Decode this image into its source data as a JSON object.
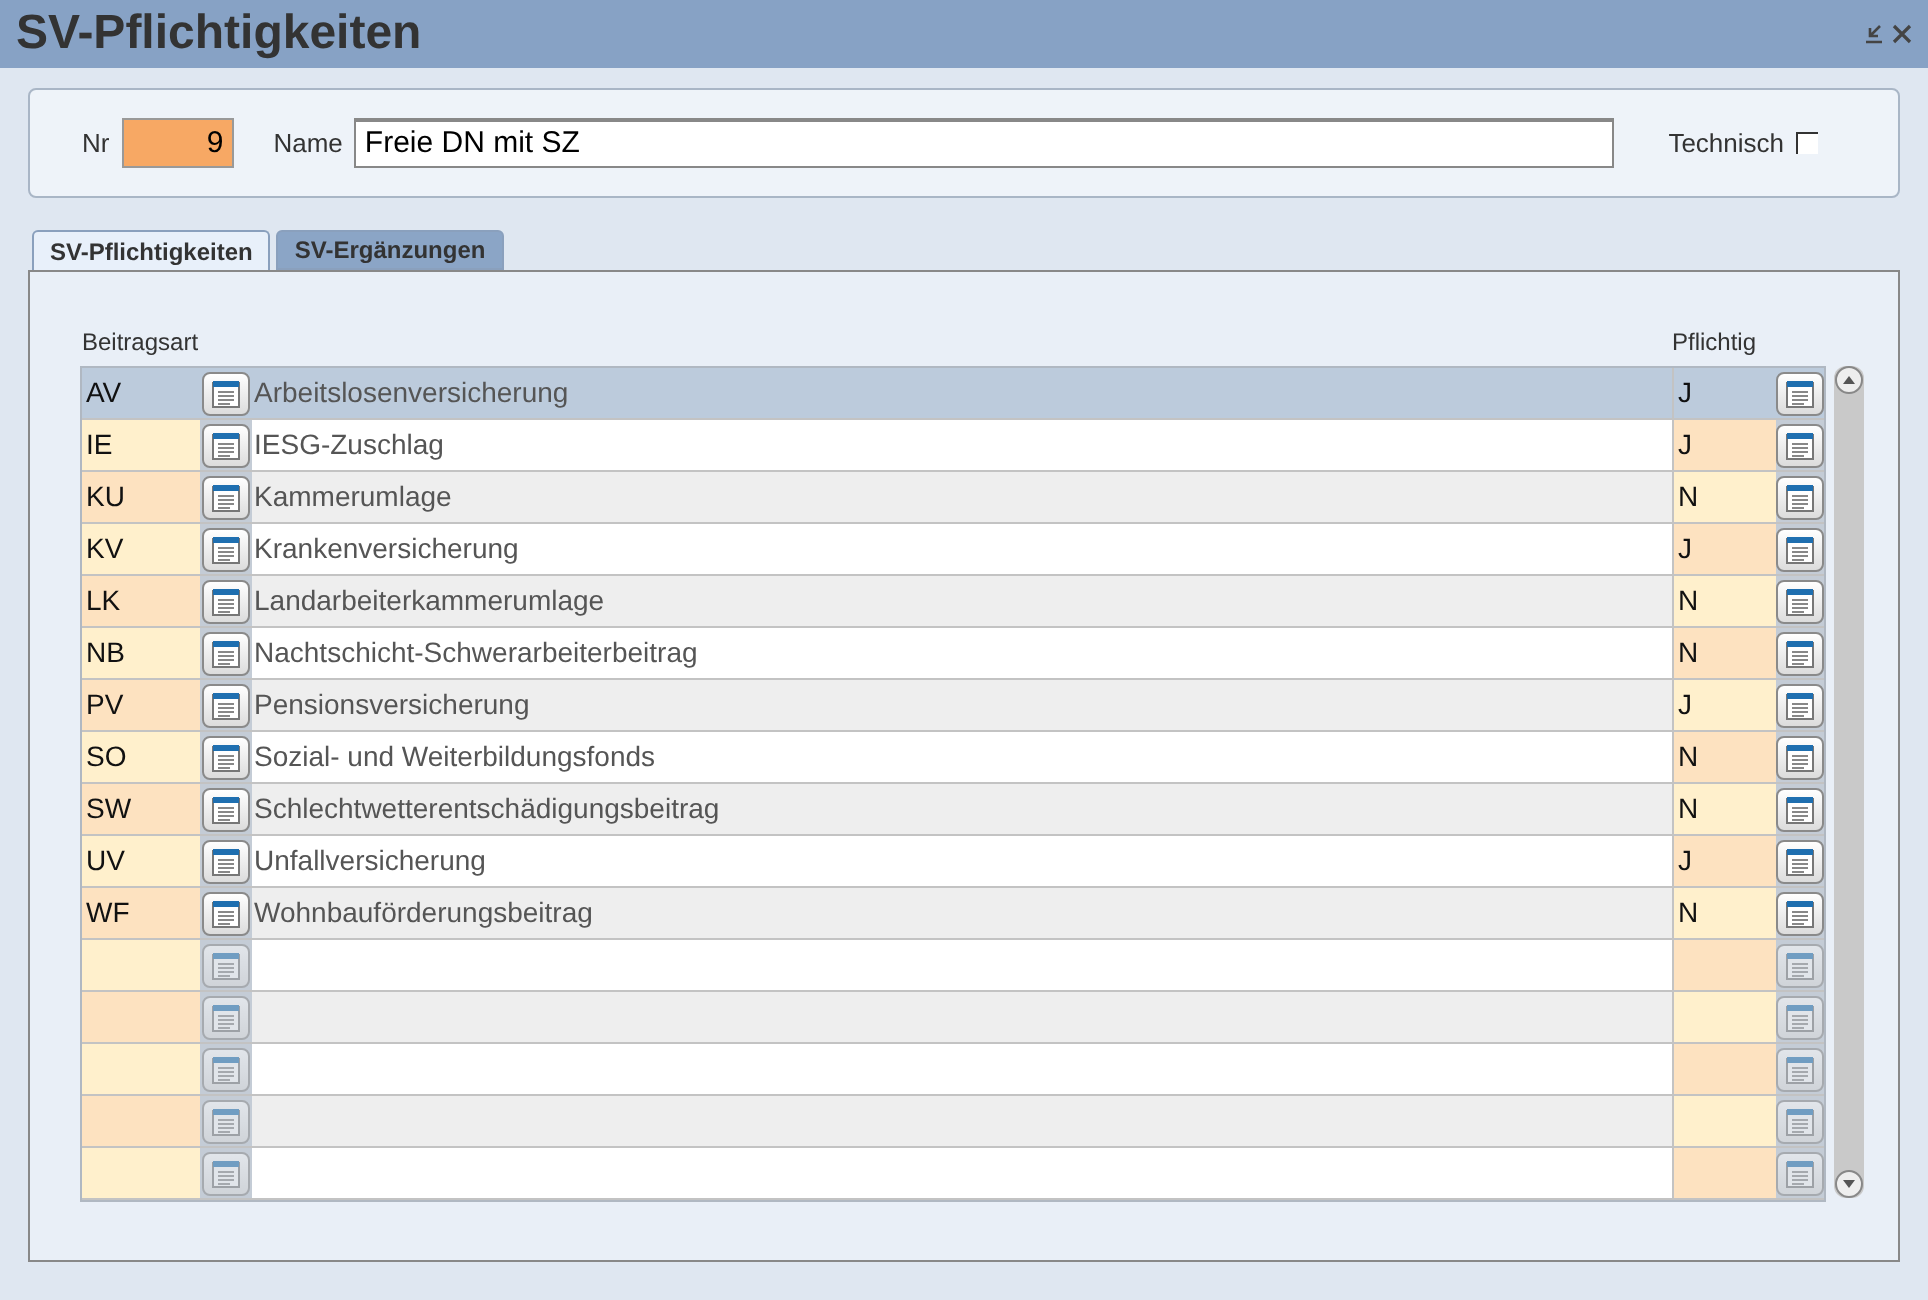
{
  "window": {
    "title": "SV-Pflichtigkeiten"
  },
  "header": {
    "nr_label": "Nr",
    "nr_value": "9",
    "name_label": "Name",
    "name_value": "Freie DN mit SZ",
    "technisch_label": "Technisch",
    "technisch_checked": false
  },
  "tabs": [
    {
      "label": "SV-Pflichtigkeiten",
      "selected": true
    },
    {
      "label": "SV-Ergänzungen",
      "selected": false
    }
  ],
  "table": {
    "columns": [
      "Beitragsart",
      "Pflichtig"
    ],
    "rows": [
      {
        "kind": "entry",
        "code": "AV",
        "name": "Arbeitslosenversicherung",
        "pflichtig": "J",
        "selected": true
      },
      {
        "kind": "entry",
        "code": "IE",
        "name": "IESG-Zuschlag",
        "pflichtig": "J",
        "selected": false
      },
      {
        "kind": "entry",
        "code": "KU",
        "name": "Kammerumlage",
        "pflichtig": "N",
        "selected": false
      },
      {
        "kind": "entry",
        "code": "KV",
        "name": "Krankenversicherung",
        "pflichtig": "J",
        "selected": false
      },
      {
        "kind": "entry",
        "code": "LK",
        "name": "Landarbeiterkammerumlage",
        "pflichtig": "N",
        "selected": false
      },
      {
        "kind": "entry",
        "code": "NB",
        "name": "Nachtschicht-Schwerarbeiterbeitrag",
        "pflichtig": "N",
        "selected": false
      },
      {
        "kind": "entry",
        "code": "PV",
        "name": "Pensionsversicherung",
        "pflichtig": "J",
        "selected": false
      },
      {
        "kind": "entry",
        "code": "SO",
        "name": "Sozial- und Weiterbildungsfonds",
        "pflichtig": "N",
        "selected": false
      },
      {
        "kind": "entry",
        "code": "SW",
        "name": "Schlechtwetterentschädigungsbeitrag",
        "pflichtig": "N",
        "selected": false
      },
      {
        "kind": "entry",
        "code": "UV",
        "name": "Unfallversicherung",
        "pflichtig": "J",
        "selected": false
      },
      {
        "kind": "entry",
        "code": "WF",
        "name": "Wohnbauförderungsbeitrag",
        "pflichtig": "N",
        "selected": false
      },
      {
        "kind": "blank",
        "selected": false
      },
      {
        "kind": "blank",
        "selected": false
      },
      {
        "kind": "blank",
        "selected": false
      },
      {
        "kind": "blank",
        "selected": false
      },
      {
        "kind": "blank",
        "selected": false
      }
    ]
  }
}
